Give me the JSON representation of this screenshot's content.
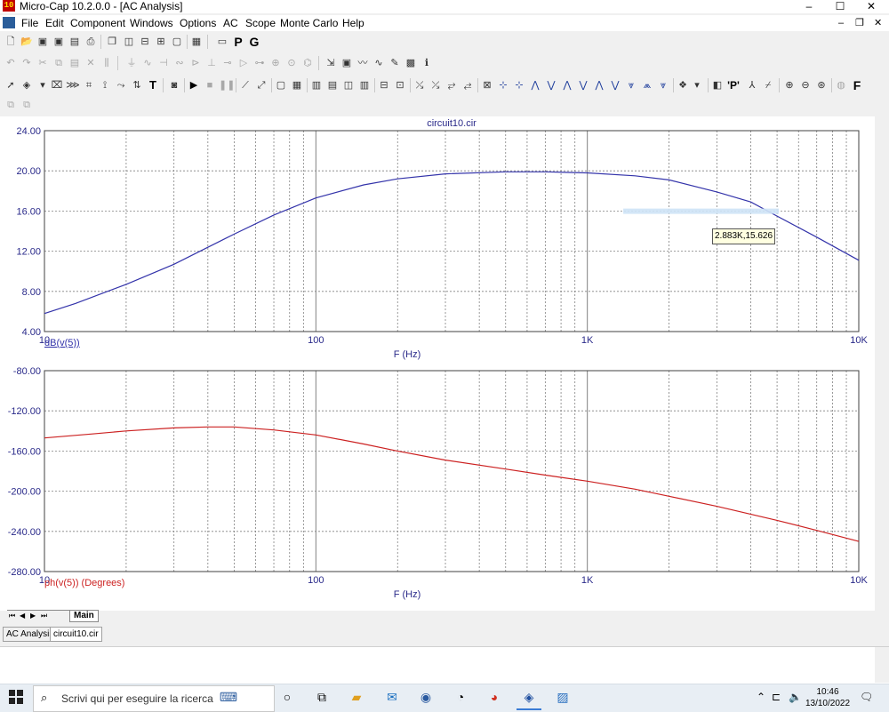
{
  "window": {
    "title": "Micro-Cap 10.2.0.0 - [AC Analysis]",
    "app_icon_text": "10",
    "minimize": "–",
    "maximize": "☐",
    "close": "✕"
  },
  "menu": {
    "items": [
      "File",
      "Edit",
      "Component",
      "Windows",
      "Options",
      "AC",
      "Scope",
      "Monte Carlo",
      "Help"
    ],
    "right": {
      "minimize": "–",
      "restore": "❐",
      "close": "✕"
    }
  },
  "toolbar": {
    "p_label": "P",
    "g_label": "G",
    "font_label": "F",
    "text_tool": "T",
    "peak_label": "'P'"
  },
  "chart_data": [
    {
      "type": "line",
      "title": "circuit10.cir",
      "xscale": "log",
      "xlim": [
        10,
        10000
      ],
      "xticks": [
        "10",
        "100",
        "1K",
        "10K"
      ],
      "xlabel": "F (Hz)",
      "ylabel": "dB(v(5))",
      "ylim": [
        4,
        24
      ],
      "yticks": [
        "24.00",
        "20.00",
        "16.00",
        "12.00",
        "8.00",
        "4.00"
      ],
      "grid": true,
      "color": "#3333aa",
      "x": [
        10,
        13,
        20,
        30,
        50,
        70,
        100,
        150,
        200,
        300,
        500,
        700,
        1000,
        1500,
        2000,
        3000,
        4000,
        5000,
        7000,
        10000
      ],
      "y": [
        5.8,
        6.8,
        8.7,
        10.7,
        13.7,
        15.6,
        17.3,
        18.6,
        19.2,
        19.7,
        19.9,
        19.9,
        19.8,
        19.5,
        19.1,
        17.9,
        16.9,
        15.5,
        13.4,
        11.1
      ],
      "cursor_label": "2.883K,15.626",
      "cursor": {
        "x": 2883,
        "y": 15.626
      }
    },
    {
      "type": "line",
      "xscale": "log",
      "xlim": [
        10,
        10000
      ],
      "xticks": [
        "10",
        "100",
        "1K",
        "10K"
      ],
      "xlabel": "F (Hz)",
      "ylabel": "ph(v(5)) (Degrees)",
      "ylim": [
        -280,
        -80
      ],
      "yticks": [
        "-80.00",
        "-120.00",
        "-160.00",
        "-200.00",
        "-240.00",
        "-280.00"
      ],
      "grid": true,
      "color": "#cc2222",
      "x": [
        10,
        15,
        20,
        30,
        40,
        50,
        70,
        100,
        150,
        200,
        300,
        500,
        700,
        1000,
        1500,
        2000,
        3000,
        5000,
        7000,
        10000
      ],
      "y": [
        -147,
        -143,
        -140,
        -137,
        -136,
        -136,
        -139,
        -144,
        -153,
        -160,
        -169,
        -178,
        -184,
        -190,
        -198,
        -205,
        -215,
        -229,
        -239,
        -250
      ]
    }
  ],
  "tabs": {
    "plot_tab": "Main",
    "analysis_tab": "AC Analysis",
    "file_tab": "circuit10.cir"
  },
  "taskbar": {
    "search_placeholder": "Scrivi qui per eseguire la ricerca",
    "time": "10:46",
    "date": "13/10/2022"
  }
}
